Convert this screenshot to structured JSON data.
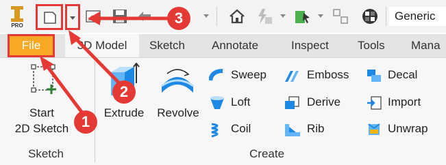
{
  "qat": {
    "material_value": "Generic"
  },
  "tabs": [
    {
      "label": "File"
    },
    {
      "label": "3D Model"
    },
    {
      "label": "Sketch"
    },
    {
      "label": "Annotate"
    },
    {
      "label": "Inspect"
    },
    {
      "label": "Tools"
    },
    {
      "label": "Mana"
    }
  ],
  "sketch_group": {
    "start_sketch_line1": "Start",
    "start_sketch_line2": "2D Sketch",
    "label": "Sketch"
  },
  "create_group": {
    "label": "Create",
    "big_buttons": [
      {
        "label": "Extrude"
      },
      {
        "label": "Revolve"
      }
    ],
    "col1": [
      {
        "label": "Sweep"
      },
      {
        "label": "Loft"
      },
      {
        "label": "Coil"
      }
    ],
    "col2": [
      {
        "label": "Emboss"
      },
      {
        "label": "Derive"
      },
      {
        "label": "Rib"
      }
    ],
    "col3": [
      {
        "label": "Decal"
      },
      {
        "label": "Import"
      },
      {
        "label": "Unwrap"
      }
    ]
  },
  "callouts": [
    {
      "number": "1"
    },
    {
      "number": "2"
    },
    {
      "number": "3"
    }
  ],
  "colors": {
    "file_tab": "#f9a825",
    "callout_red": "#e53935",
    "highlight_border": "#e53935"
  }
}
